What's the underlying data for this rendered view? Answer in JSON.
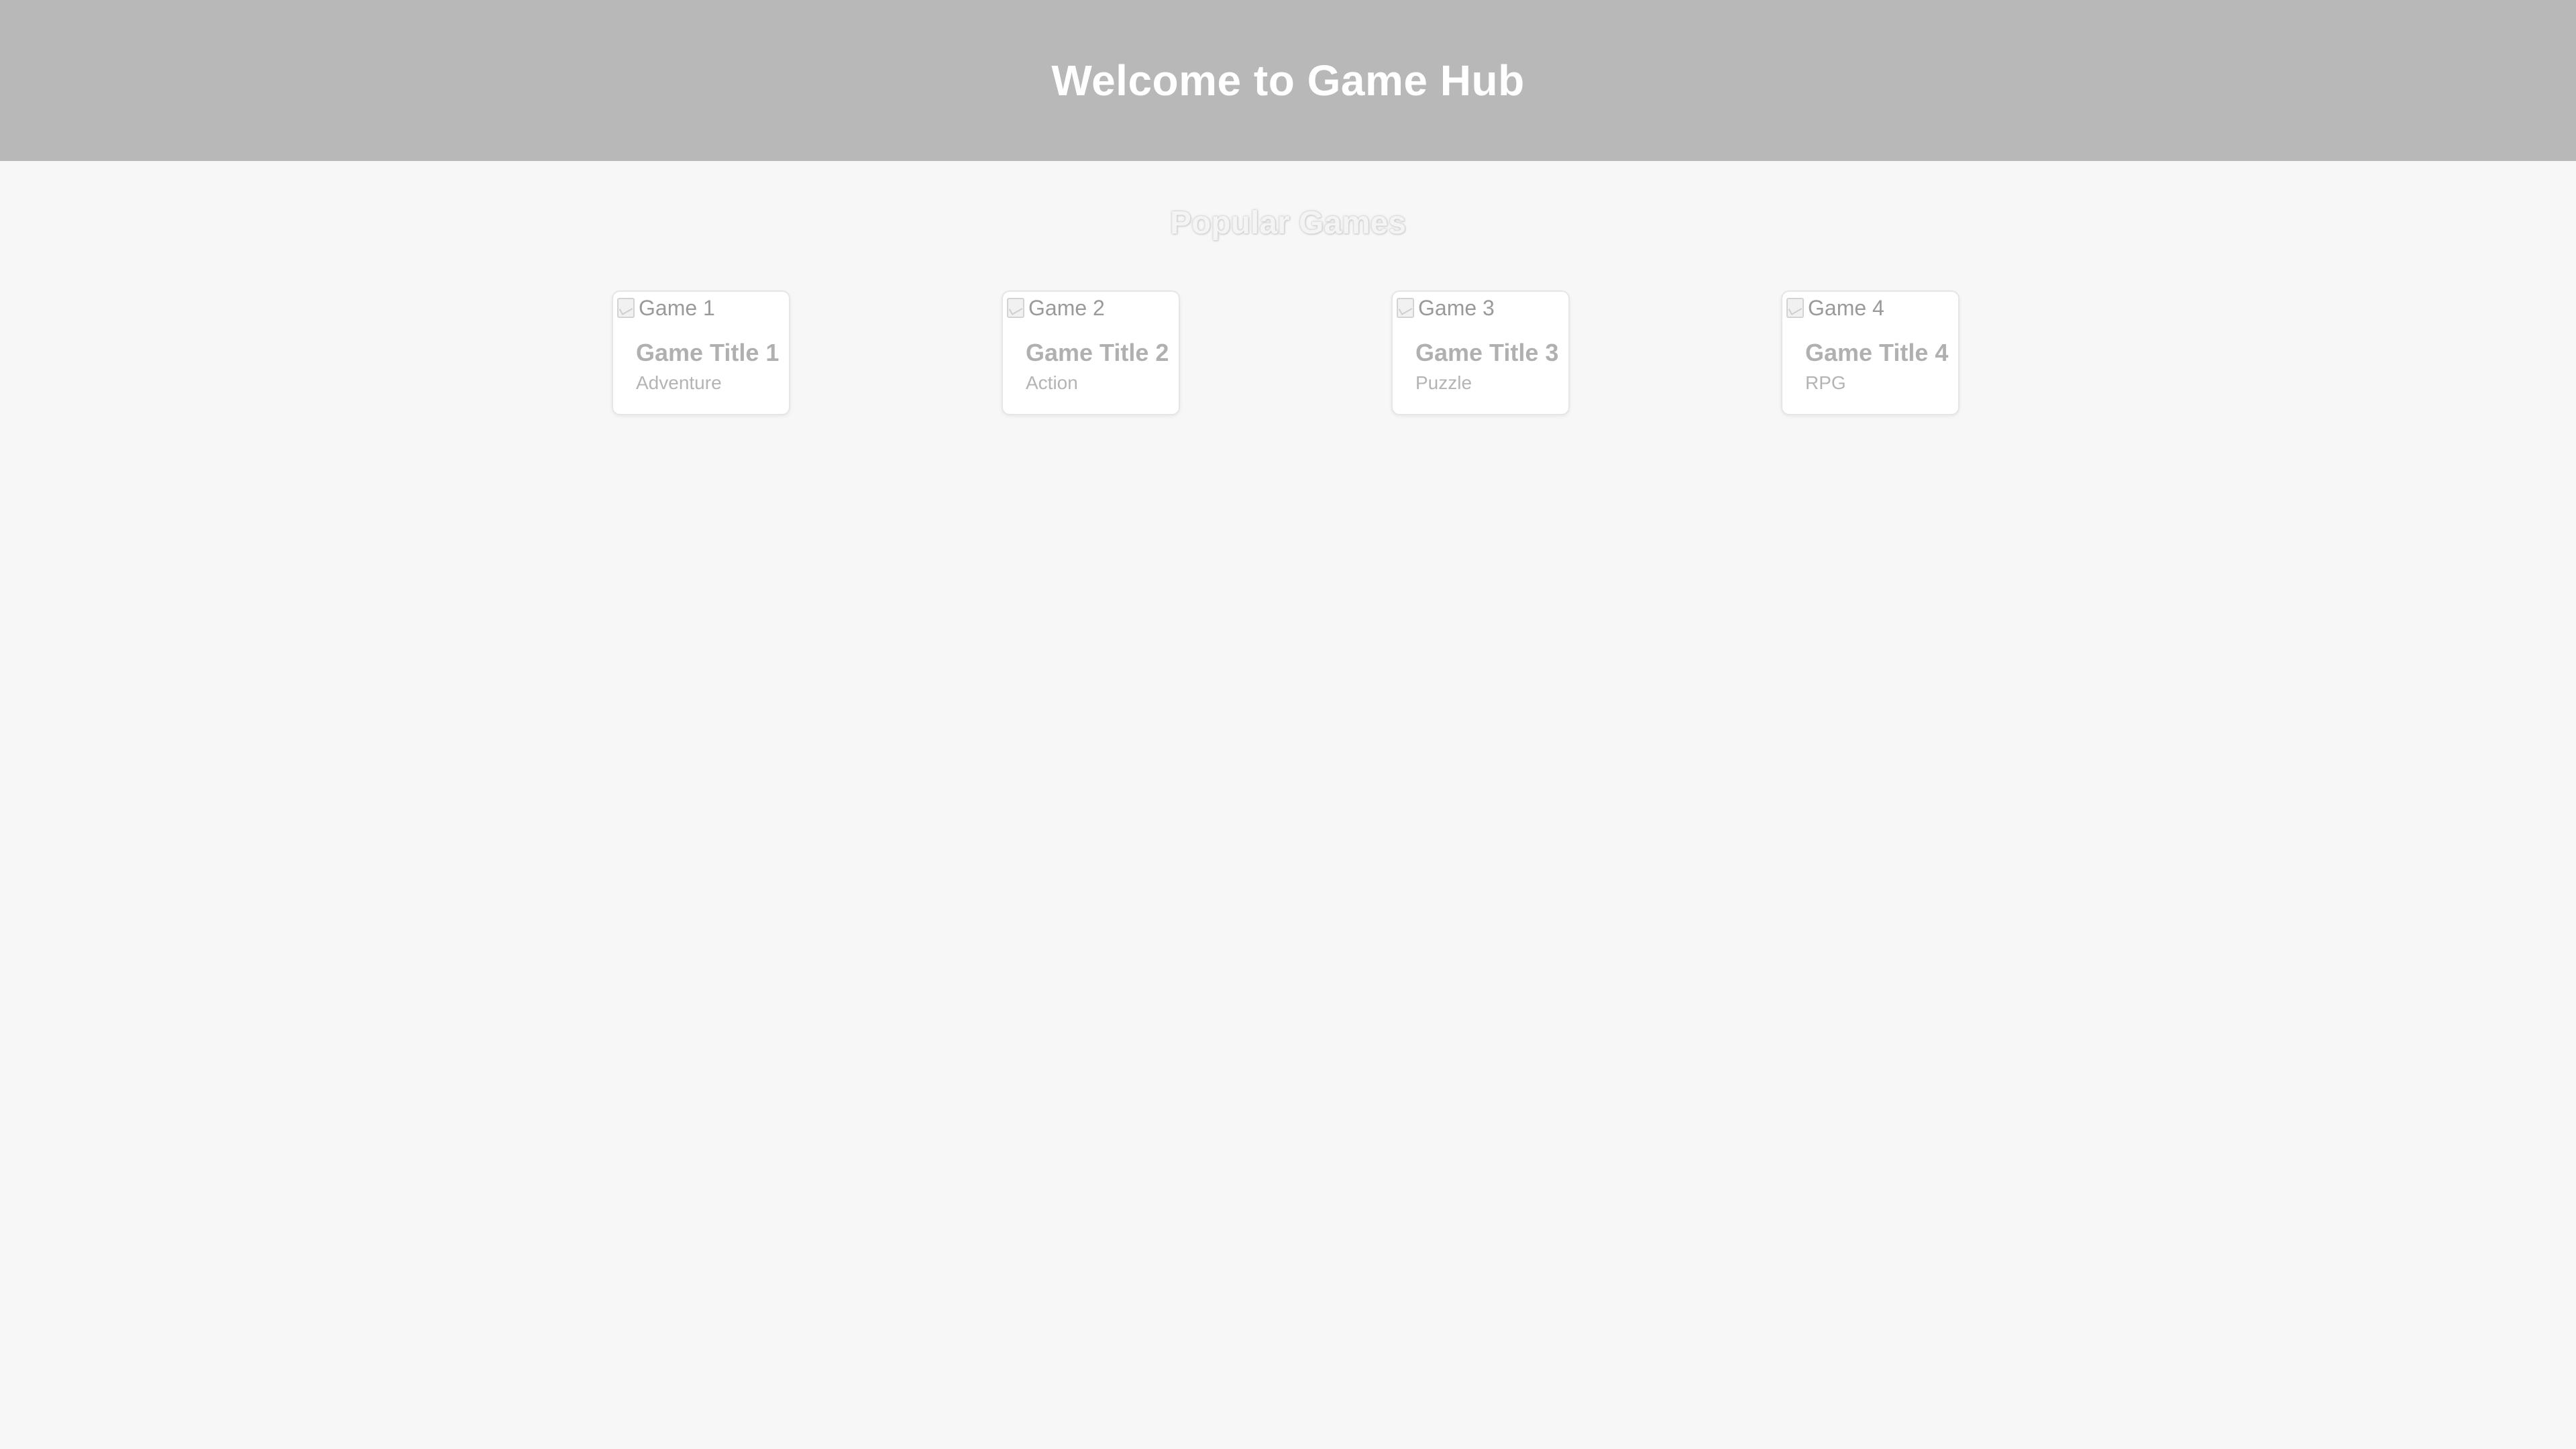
{
  "header": {
    "title": "Welcome to Game Hub"
  },
  "section": {
    "title": "Popular Games"
  },
  "games": [
    {
      "image_alt": "Game 1",
      "title": "Game Title 1",
      "genre": "Adventure"
    },
    {
      "image_alt": "Game 2",
      "title": "Game Title 2",
      "genre": "Action"
    },
    {
      "image_alt": "Game 3",
      "title": "Game Title 3",
      "genre": "Puzzle"
    },
    {
      "image_alt": "Game 4",
      "title": "Game Title 4",
      "genre": "RPG"
    }
  ],
  "colors": {
    "header_background": "#b8b8b8",
    "page_background": "#f7f7f7",
    "card_background": "#ffffff"
  },
  "icons": {
    "image_placeholder": "broken-image-icon"
  }
}
